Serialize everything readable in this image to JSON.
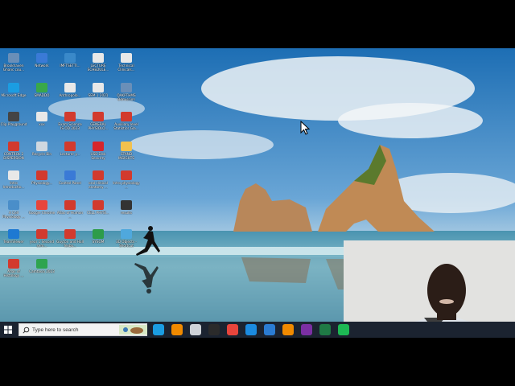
{
  "desktop": {
    "icons": [
      {
        "label": "Brookhaven Ghanc cou...",
        "color": "#6a8fb8"
      },
      {
        "label": "Network",
        "color": "#3a7ad6"
      },
      {
        "label": "IMFTSETTI...",
        "color": "#3a89c9"
      },
      {
        "label": "LECTURE SCHEDULE...",
        "color": "#e8e8e8"
      },
      {
        "label": "Technical Clinicals...",
        "color": "#e8e8e8"
      },
      {
        "label": "Microsoft Edge",
        "color": "#1b9de2"
      },
      {
        "label": "SMADDO",
        "color": "#39a84a"
      },
      {
        "label": "Anthropolo...",
        "color": "#e8e8e8"
      },
      {
        "label": "SEM 1 2021",
        "color": "#e8e8e8"
      },
      {
        "label": "OAKPTHMS Odmission",
        "color": "#6a8fb8"
      },
      {
        "label": "Clip Playground",
        "color": "#444"
      },
      {
        "label": "xxx",
        "color": "#e8e8e8"
      },
      {
        "label": "Exam Science IS OD 2023",
        "color": "#d23a2e"
      },
      {
        "label": "GENERAL PHYSIOLO...",
        "color": "#d23a2e"
      },
      {
        "label": "Auxiliary level Statistics Gla...",
        "color": "#d23a2e"
      },
      {
        "label": "CONTROL 2 DISPERSION",
        "color": "#d23a2e"
      },
      {
        "label": "Recycle Bin",
        "color": "#cfd8e0"
      },
      {
        "label": "Lecturer y...",
        "color": "#d23a2e"
      },
      {
        "label": "USB Disk Security",
        "color": "#d6252b"
      },
      {
        "label": "STAND INSIGHTS",
        "color": "#f2c14e"
      },
      {
        "label": "Intro Introductio...",
        "color": "#e8e8e8"
      },
      {
        "label": "Physiology...",
        "color": "#d23a2e"
      },
      {
        "label": "Control Panel",
        "color": "#3a7ad6"
      },
      {
        "label": "oral clinical anatomy ...",
        "color": "#d23a2e"
      },
      {
        "label": "Intro physiology ...",
        "color": "#d23a2e"
      },
      {
        "label": "A Cell Physiology ...",
        "color": "#4a8ec9"
      },
      {
        "label": "Google Chrome",
        "color": "#e8453c"
      },
      {
        "label": "Atlas of Human ...",
        "color": "#d23a2e"
      },
      {
        "label": "CELL PHYSI...",
        "color": "#d23a2e"
      },
      {
        "label": "results",
        "color": "#333"
      },
      {
        "label": "TeamViewer",
        "color": "#1d79d2"
      },
      {
        "label": "year 1 Second sem...",
        "color": "#d23a2e"
      },
      {
        "label": "Guyton and Hall Texbo...",
        "color": "#d23a2e"
      },
      {
        "label": "SYSOM",
        "color": "#2d9c4a"
      },
      {
        "label": "3D Objects - Shortcut",
        "color": "#4fa8dd"
      },
      {
        "label": "Atlas of Histology ...",
        "color": "#d23a2e"
      },
      {
        "label": "Camtasia 2023",
        "color": "#2ea44f"
      }
    ]
  },
  "taskbar": {
    "search_placeholder": "Type here to search",
    "apps": [
      {
        "icon": "edge-icon",
        "color": "#1b9de2"
      },
      {
        "icon": "vlc-icon",
        "color": "#f08a00"
      },
      {
        "icon": "store-icon",
        "color": "#cfd3d8"
      },
      {
        "icon": "obs-icon",
        "color": "#2b2b2b"
      },
      {
        "icon": "chrome-icon",
        "color": "#e8453c"
      },
      {
        "icon": "ie-icon",
        "color": "#1b8be0"
      },
      {
        "icon": "mail-icon",
        "color": "#2b7cd3"
      },
      {
        "icon": "vlc-icon",
        "color": "#f08a00"
      },
      {
        "icon": "onenote-icon",
        "color": "#7b2fa3"
      },
      {
        "icon": "excel-icon",
        "color": "#1f7a45"
      },
      {
        "icon": "spotify-icon",
        "color": "#1db954"
      }
    ]
  },
  "colors": {
    "sky_top": "#1f6fb0",
    "sea": "#3f8fa8",
    "taskbar": "#1b2330"
  }
}
